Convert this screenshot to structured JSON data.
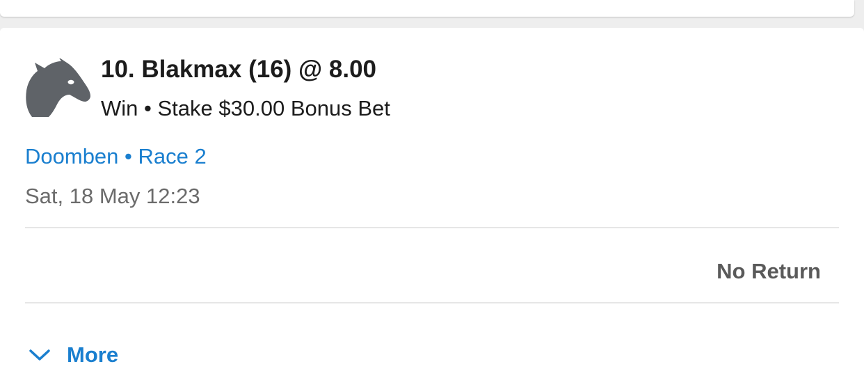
{
  "bet": {
    "runner_icon": "horse-head-icon",
    "title": "10. Blakmax (16) @ 8.00",
    "bet_type": "Win",
    "separator": "•",
    "stake_text": "Stake $30.00 Bonus Bet",
    "meeting": "Doomben",
    "race": "Race 2",
    "datetime": "Sat, 18 May 12:23",
    "return_status": "No Return",
    "more_label": "More",
    "more_icon": "chevron-down-icon"
  },
  "colors": {
    "link": "#1a7fcf",
    "text_primary": "#1c1c1c",
    "text_secondary": "#6b6b6b",
    "icon_gray": "#5f6368"
  }
}
